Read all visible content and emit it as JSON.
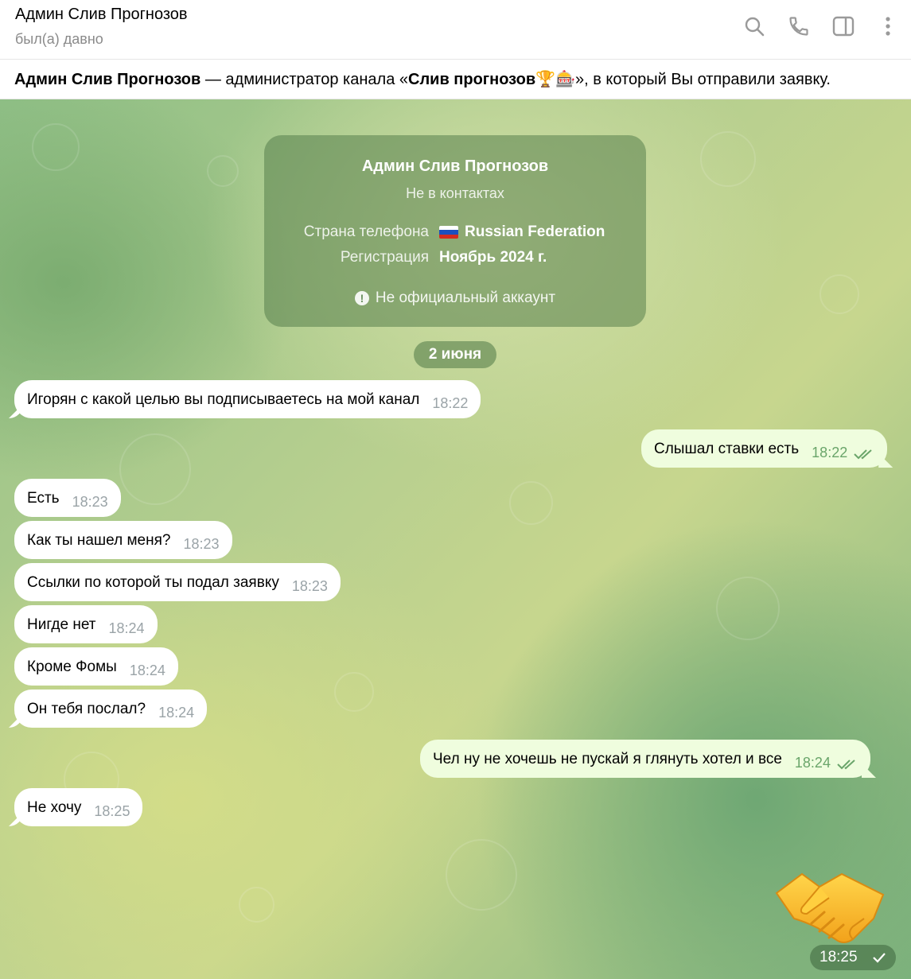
{
  "header": {
    "title": "Админ Слив Прогнозов",
    "status": "был(а) давно",
    "actions": [
      "search-icon",
      "phone-icon",
      "sidebar-icon",
      "more-icon"
    ]
  },
  "banner": {
    "name": "Админ Слив Прогнозов",
    "text_mid": " — администратор канала «",
    "channel": "Слив прогнозов",
    "channel_emoji": "🏆🎰",
    "text_end": "», в который Вы отправили заявку."
  },
  "info_card": {
    "name": "Админ Слив Прогнозов",
    "contacts_status": "Не в контактах",
    "phone_country_label": "Страна телефона",
    "phone_country_value": "Russian Federation",
    "registration_label": "Регистрация",
    "registration_value": "Ноябрь 2024 г.",
    "official_note": "Не официальный аккаунт"
  },
  "date_separator": "2 июня",
  "messages": [
    {
      "dir": "in",
      "text": "Игорян с какой целью вы подписываетесь на мой канал",
      "time": "18:22"
    },
    {
      "dir": "out",
      "text": "Слышал ставки есть",
      "time": "18:22",
      "read": true
    },
    {
      "dir": "in",
      "text": "Есть",
      "time": "18:23"
    },
    {
      "dir": "in",
      "text": "Как ты нашел меня?",
      "time": "18:23"
    },
    {
      "dir": "in",
      "text": "Ссылки по которой ты подал заявку",
      "time": "18:23"
    },
    {
      "dir": "in",
      "text": "Нигде нет",
      "time": "18:24"
    },
    {
      "dir": "in",
      "text": "Кроме Фомы",
      "time": "18:24"
    },
    {
      "dir": "in",
      "text": "Он тебя послал?",
      "time": "18:24"
    },
    {
      "dir": "out",
      "text": "Чел ну не хочешь не пускай я глянуть хотел и все",
      "time": "18:24",
      "read": true
    },
    {
      "dir": "in",
      "text": "Не хочу",
      "time": "18:25"
    }
  ],
  "sticker": {
    "emoji": "handshake",
    "time": "18:25",
    "status": "sent"
  },
  "colors": {
    "incoming_bubble": "#ffffff",
    "outgoing_bubble": "#effdde",
    "outgoing_time": "#6aa56a",
    "incoming_time": "#9aa3a7"
  }
}
